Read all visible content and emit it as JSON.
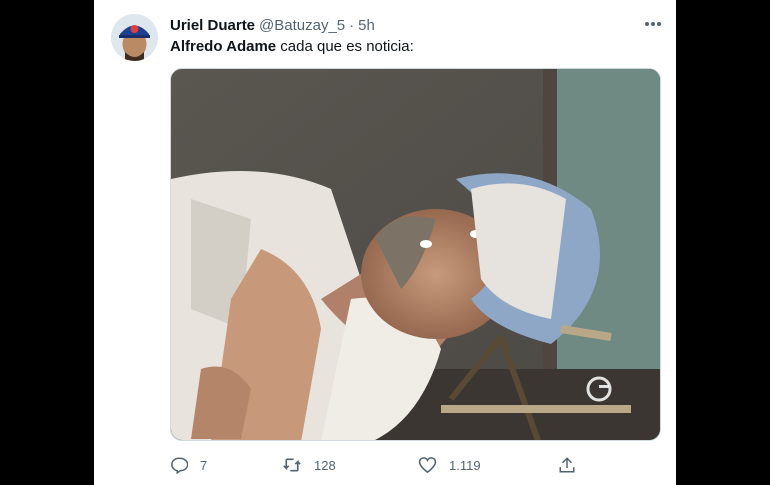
{
  "tweet": {
    "author_name": "Uriel Duarte",
    "handle": "@Batuzay_5",
    "separator": "·",
    "time": "5h",
    "mention": "Alfredo Adame",
    "text": " cada que es noticia:"
  },
  "actions": {
    "reply_count": "7",
    "retweet_count": "128",
    "like_count": "1.119"
  },
  "colors": {
    "text_primary": "#0f1419",
    "text_secondary": "#536471",
    "background": "#ffffff",
    "outer_background": "#000000"
  },
  "icons": {
    "more": "more-icon",
    "reply": "reply-icon",
    "retweet": "retweet-icon",
    "like": "like-icon",
    "share": "share-icon",
    "watermark": "channel-logo"
  }
}
